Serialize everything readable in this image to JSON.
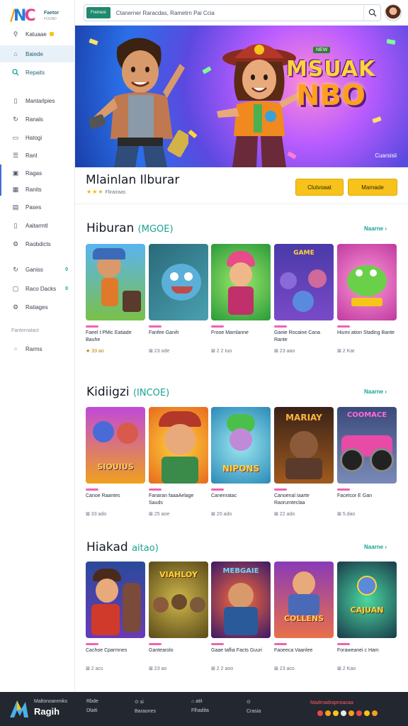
{
  "sidebar": {
    "logo_text": "Faetor",
    "logo_sub": "FOUND",
    "items": [
      {
        "label": "Katuaae",
        "icon": "store-icon",
        "badge": ""
      },
      {
        "label": "Baiede",
        "icon": "home-icon",
        "badge": ""
      },
      {
        "label": "Repaits",
        "icon": "search-icon",
        "badge": ""
      },
      {
        "label": "Mantarlpies",
        "icon": "bookmark-icon",
        "badge": ""
      },
      {
        "label": "Ranals",
        "icon": "refresh-icon",
        "badge": ""
      },
      {
        "label": "Hatogi",
        "icon": "folder-icon",
        "badge": ""
      },
      {
        "label": "Ranl",
        "icon": "list-icon",
        "badge": ""
      },
      {
        "label": "Ragas",
        "icon": "monitor-icon",
        "badge": ""
      },
      {
        "label": "Ranits",
        "icon": "grid-icon",
        "badge": ""
      },
      {
        "label": "Pases",
        "icon": "document-icon",
        "badge": ""
      },
      {
        "label": "Aaitarmtl",
        "icon": "phone-icon",
        "badge": ""
      },
      {
        "label": "Raobdicts",
        "icon": "gear-icon",
        "badge": ""
      },
      {
        "label": "Ganiss",
        "icon": "refresh-icon",
        "badge": "0"
      },
      {
        "label": "Raco Dacks",
        "icon": "calendar-icon",
        "badge": "0"
      },
      {
        "label": "Ratiages",
        "icon": "settings-icon",
        "badge": ""
      }
    ],
    "section_label": "Fanternalact",
    "footer_item": "Rarms"
  },
  "search": {
    "chip": "Freinest",
    "value": "Ctanerner Raracdas, Rametrn Pai Ccia"
  },
  "hero": {
    "tag": "NEW",
    "title_line1": "MSUAK",
    "title_line2": "NBO",
    "counter": "Cuarsisii"
  },
  "game": {
    "title": "Mlainlan Ilburar",
    "stars": "★★★",
    "rating_text": "Flirairaas",
    "primary_button": "Clutvoaat",
    "secondary_button": "Marnade"
  },
  "sections": [
    {
      "title": "Hiburan",
      "subtitle": "(MGOE)",
      "more": "Naarne",
      "cards": [
        {
          "name": "Faeel t PMic Eatiade Bauhe",
          "meta": "★ 33 ao",
          "rated": true
        },
        {
          "name": "Fanfee Ganih",
          "meta": "⊠ 23 ode",
          "rated": false
        },
        {
          "name": "Frooe Mamlanne",
          "meta": "⊠ 2 2 tuo",
          "rated": false
        },
        {
          "name": "Ganie Rocaine Cana Rante",
          "meta": "⊠ 23 aao",
          "rated": false
        },
        {
          "name": "Hiumi ation Stading Bante",
          "meta": "⊠ 2 Kat",
          "rated": false
        }
      ]
    },
    {
      "title": "Kidiigzi",
      "subtitle": "(INCOE)",
      "more": "Naarne",
      "cards": [
        {
          "name": "Canoe Raantes",
          "meta": "⊠ 33 ado",
          "rated": false
        },
        {
          "name": "Fanaran faaaAelage Sauds",
          "meta": "⊠ 25 aoe",
          "rated": false
        },
        {
          "name": "Canenratac",
          "meta": "⊠ 20 ado",
          "rated": false
        },
        {
          "name": "Canoenal Iaarte Raorumteclaa",
          "meta": "⊠ 22 ado",
          "rated": false
        },
        {
          "name": "Facetcor E Gan",
          "meta": "⊠ 5.dao",
          "rated": false
        }
      ]
    },
    {
      "title": "Hiakad",
      "subtitle": "aitao)",
      "more": "Naarne",
      "cards": [
        {
          "name": "Cachoe Cparmnes",
          "meta": "⊠ 2 acs",
          "rated": false
        },
        {
          "name": "Gantearolo",
          "meta": "⊠ 23 ao",
          "rated": false
        },
        {
          "name": "Gaae taflia Facts Guuri",
          "meta": "⊠ 2 2 aoo",
          "rated": false
        },
        {
          "name": "Faoeeca Vaanlee",
          "meta": "⊠ 23 aco",
          "rated": false
        },
        {
          "name": "Foraweanei c Ham",
          "meta": "⊠ 2 Kao",
          "rated": false
        }
      ]
    }
  ],
  "footer": {
    "brand_small": "Maltonoanmiks",
    "brand_big": "Ragih",
    "links": [
      {
        "l1": "Rbde",
        "l2": "Dlaiti"
      },
      {
        "l1": "⊙ si",
        "l2": "Baraones"
      },
      {
        "l1": "⌂ atit",
        "l2": "Flhadita"
      },
      {
        "l1": "⊙",
        "l2": "Crasia"
      }
    ],
    "red_text": "Madrnadrapnoacaa"
  }
}
